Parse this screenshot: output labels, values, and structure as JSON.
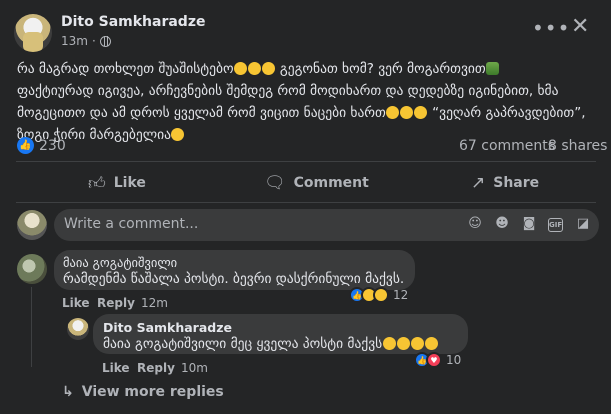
{
  "post": {
    "author": "Dito Samkharadze",
    "time": "13m",
    "text_line1": "რა მაგრად თოხლეთ შუაშისტებო",
    "text_line1b": " გეგონათ ხომ? ვერ მოგართვით",
    "text_line2": "ფაქტიურად იგივეა, არჩევნების შემდეგ რომ მოდიხართ და დედებზე იგინებით, ხმა",
    "text_line3a": "მოგეცითო და ამ დროს ყველამ რომ ვიცით ნაცები ხართ",
    "text_line3b": " “ვეღარ გაპრავდებით”,",
    "text_line4": "ზოგი ჭირი მარგებელია"
  },
  "stats": {
    "likes": "230",
    "comments": "67 comments",
    "shares": "8 shares"
  },
  "actions": {
    "like": "Like",
    "comment": "Comment",
    "share": "Share"
  },
  "composer": {
    "placeholder": "Write a comment..."
  },
  "comments": [
    {
      "name": "მაია გოგატიშვილი",
      "text": "რამდენმა წაშალა პოსტი. ბევრი დასქრინული მაქვს.",
      "like": "Like",
      "reply": "Reply",
      "time": "12m",
      "reaction_count": "12"
    },
    {
      "name": "Dito Samkharadze",
      "text": "მაია გოგატიშვილი მეც ყველა პოსტი მაქვს",
      "like": "Like",
      "reply": "Reply",
      "time": "10m",
      "reaction_count": "10"
    }
  ],
  "view_more": "View more replies",
  "icons": {
    "more": "more-horizontal-icon",
    "close": "close-icon",
    "globe": "globe-icon",
    "like": "thumbs-up-icon",
    "comment": "speech-bubble-icon",
    "share": "share-arrow-icon",
    "sticker": "sticker-icon",
    "emoji": "smiley-icon",
    "camera": "camera-icon",
    "gif": "gif-icon",
    "avatar_sticker": "avatar-sticker-icon"
  },
  "colors": {
    "background": "#242526",
    "surface": "#3a3b3c",
    "text": "#e4e6eb",
    "muted": "#b0b3b8",
    "like_blue": "#1877f2",
    "haha_yellow": "#f7c533",
    "love_red": "#f33e58"
  }
}
